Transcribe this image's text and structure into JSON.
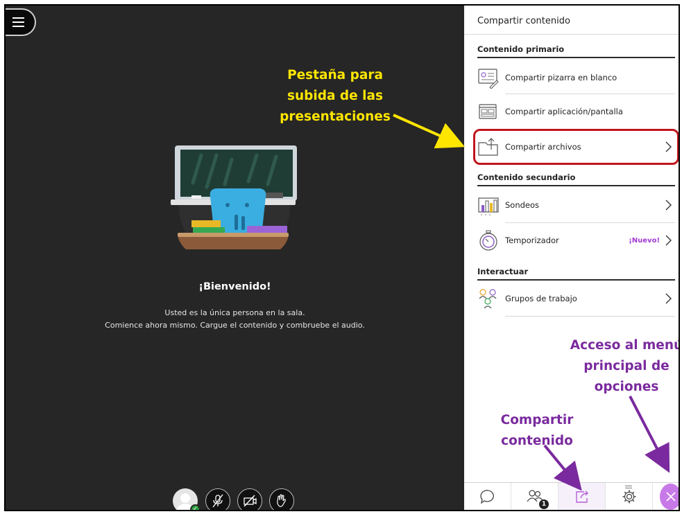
{
  "room": {
    "welcome_title": "¡Bienvenido!",
    "welcome_line_1": "Usted es la única persona en la sala.",
    "welcome_line_2": "Comience ahora mismo. Cargue el contenido y combruebe el audio."
  },
  "annotations": {
    "upload_tab": [
      "Pestaña para",
      "subida de las",
      "presentaciones"
    ],
    "main_menu": [
      "Acceso al menú",
      "principal de",
      "opciones"
    ],
    "share_content": [
      "Compartir",
      "contenido"
    ]
  },
  "panel": {
    "title": "Compartir contenido",
    "sections": {
      "primary": "Contenido primario",
      "secondary": "Contenido secundario",
      "interact": "Interactuar"
    },
    "items": {
      "whiteboard": "Compartir pizarra en blanco",
      "app_screen": "Compartir aplicación/pantalla",
      "files": "Compartir archivos",
      "polls": "Sondeos",
      "timer": "Temporizador",
      "timer_badge": "¡Nuevo!",
      "groups": "Grupos de trabajo"
    },
    "attendee_count": "1"
  },
  "colors": {
    "room_bg": "#262626",
    "annotation_yellow": "#ffe600",
    "annotation_purple": "#7a2a9e",
    "highlight_red": "#c0141d",
    "accent_purple": "#c879e8"
  },
  "icons": {
    "menu": "hamburger-icon",
    "mic": "microphone-muted-icon",
    "camera": "camera-off-icon",
    "hand": "raise-hand-icon",
    "chat": "chat-bubble-icon",
    "attendees": "attendees-icon",
    "share": "share-icon",
    "settings": "gear-icon",
    "close": "close-icon"
  }
}
